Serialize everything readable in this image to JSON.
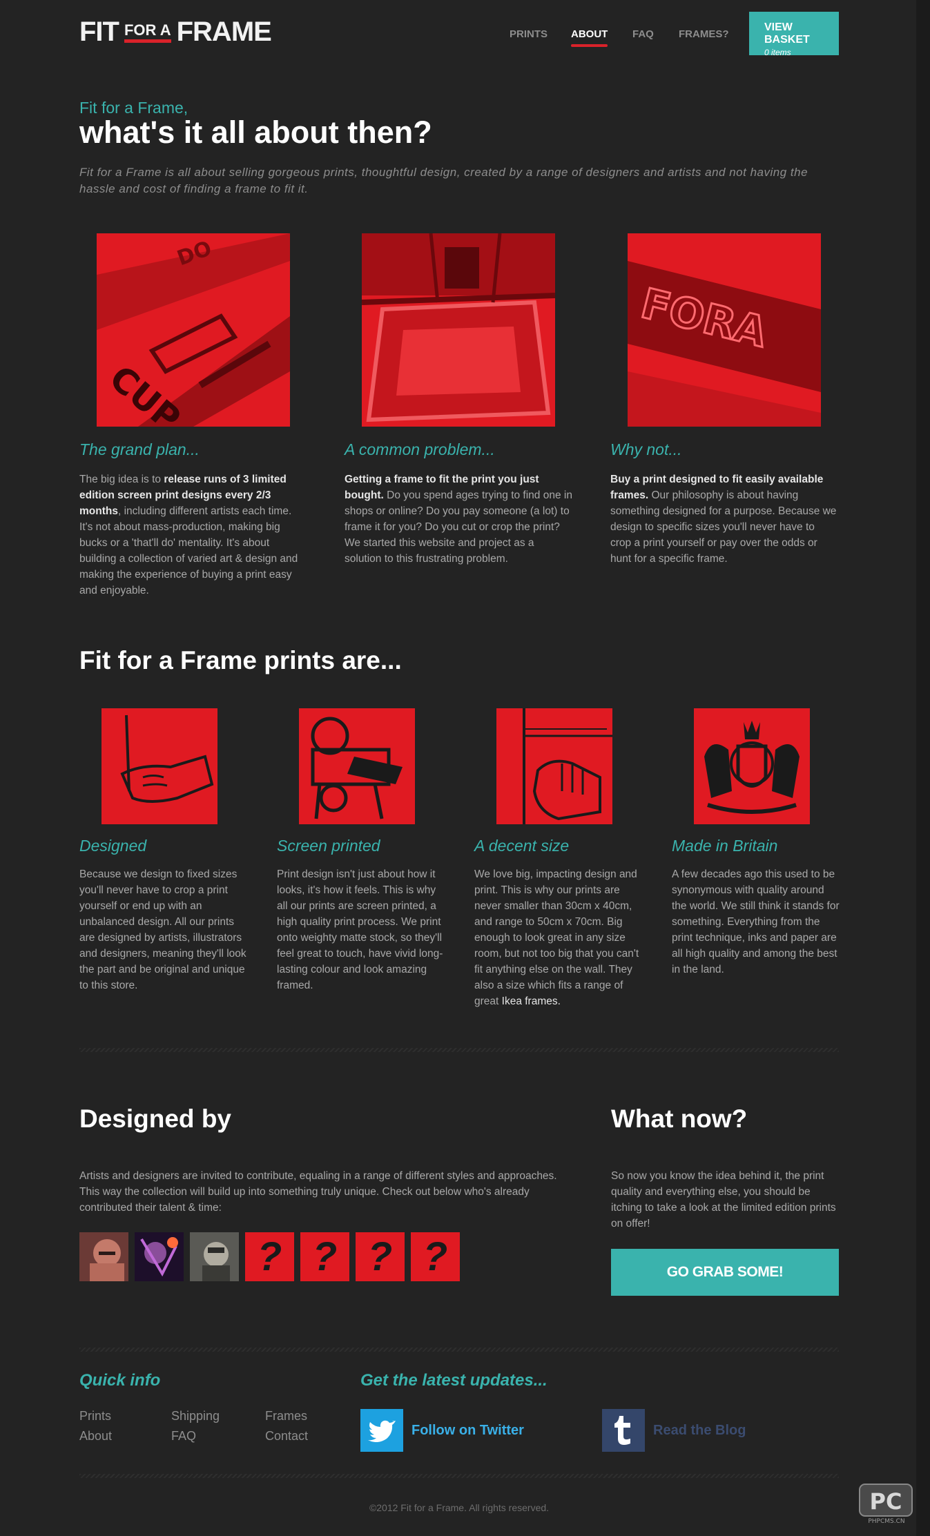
{
  "brand": {
    "logo_left": "FIT",
    "logo_mid": "FOR A",
    "logo_right": "FRAME"
  },
  "nav": {
    "items": [
      {
        "label": "PRINTS",
        "active": false
      },
      {
        "label": "ABOUT",
        "active": true
      },
      {
        "label": "FAQ",
        "active": false
      },
      {
        "label": "FRAMES?",
        "active": false
      }
    ]
  },
  "basket": {
    "title": "VIEW BASKET",
    "count": "0 items"
  },
  "intro": {
    "kicker": "Fit for a Frame,",
    "title": "what's it all about then?",
    "text": "Fit for a Frame is all about selling gorgeous prints, thoughtful design, created by a range of designers and artists and not having the hassle and cost of finding a frame to fit it."
  },
  "columns3": [
    {
      "heading": "The grand plan...",
      "pre": "The big idea is to ",
      "bold": "release runs of 3 limited edition screen print designs every 2/3 months",
      "post": ", including different artists each time. It's not about mass-production, making big bucks or a 'that'll do' mentality. It's about building a collection of varied art & design and making the experience of buying a print easy and enjoyable."
    },
    {
      "heading": "A common problem...",
      "pre": "",
      "bold": "Getting a frame to fit the print you just bought.",
      "post": " Do you spend ages trying to find one in shops or online? Do you pay someone (a lot) to frame it for you? Do you cut or crop the print? We started this website and project as a solution to this frustrating problem."
    },
    {
      "heading": "Why not...",
      "pre": "",
      "bold": "Buy a print designed to fit easily available frames.",
      "post": " Our philosophy is about having something designed for a purpose. Because we design to specific sizes you'll never have to crop a print yourself or pay over the odds or hunt for a specific frame."
    }
  ],
  "prints_heading": "Fit for a Frame prints are...",
  "columns4": [
    {
      "heading": "Designed",
      "text": "Because we design to fixed sizes you'll never have to crop a print yourself or end up with an unbalanced design. All our prints are designed by artists, illustrators and designers, meaning they'll look the part and be original and unique to this store.",
      "link": ""
    },
    {
      "heading": "Screen printed",
      "text": "Print design isn't just about how it looks, it's how it feels. This is why all our prints are screen printed, a high quality print process. We print onto weighty matte stock, so they'll feel great to touch, have vivid long-lasting colour and look amazing framed.",
      "link": ""
    },
    {
      "heading": "A decent size",
      "text": "We love big, impacting design and print. This is why our prints are never smaller than 30cm x 40cm, and range to 50cm x 70cm. Big enough to look great in any size room, but not too big that you can't fit anything else on the wall. They also a size which fits a range of great ",
      "link": "Ikea frames."
    },
    {
      "heading": "Made in Britain",
      "text": "A few decades ago this used to be synonymous with quality around the world. We still think it stands for something. Everything from the print technique, inks and paper are all high quality and among the best in the land.",
      "link": ""
    }
  ],
  "designed_by": {
    "heading": "Designed by",
    "text": "Artists and designers are invited to contribute, equaling in a range of different styles and approaches. This way the collection will build up into something truly unique. Check out below who's already contributed their talent & time:",
    "placeholder": "?"
  },
  "what_now": {
    "heading": "What now?",
    "text": "So now you know the idea behind it, the print quality and everything else, you should be itching to take a look at the limited edition prints on offer!",
    "button": "GO GRAB SOME!"
  },
  "footer": {
    "quick_heading": "Quick info",
    "links": [
      "Prints",
      "Shipping",
      "Frames",
      "About",
      "FAQ",
      "Contact"
    ],
    "updates_heading": "Get the latest updates...",
    "twitter": "Follow on Twitter",
    "blog": "Read the Blog",
    "copyright": "©2012 Fit for a Frame. All rights reserved.",
    "watermark_big": "PC",
    "watermark_small": "PHPCMS.CN"
  },
  "colors": {
    "background": "#232323",
    "accent_teal": "#3ab3ad",
    "brand_red": "#e01a22",
    "twitter_blue": "#1da1e0",
    "tumblr_navy": "#34466a"
  }
}
